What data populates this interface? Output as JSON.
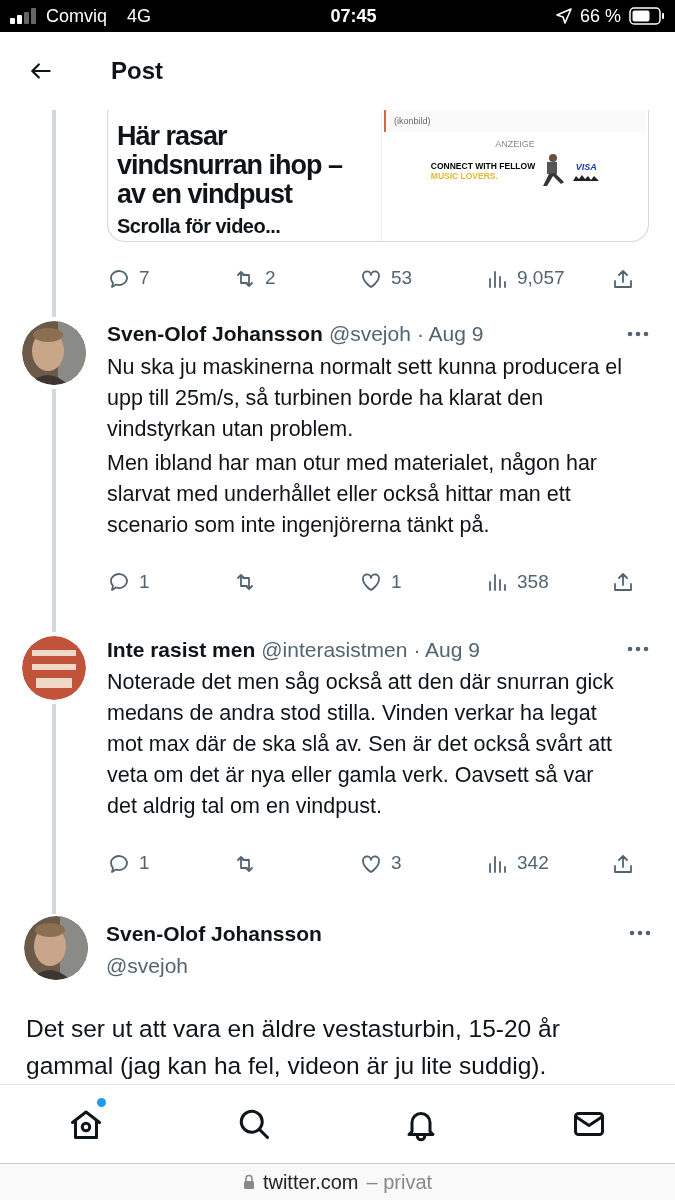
{
  "status_bar": {
    "carrier": "Comviq",
    "network": "4G",
    "time": "07:45",
    "battery": "66 %"
  },
  "header": {
    "title": "Post"
  },
  "link_card": {
    "headline": "Här rasar vindsnurran ihop – av en vindpust",
    "subline": "Scrolla för video...",
    "caption": "(ikonbild)",
    "ad_label": "ANZEIGE",
    "ad_line_1": "CONNECT WITH FELLOW",
    "ad_line_2": "MUSIC LOVERS.",
    "ad_brand": "VISA"
  },
  "card_actions": {
    "reply": "7",
    "retweet": "2",
    "like": "53",
    "views": "9,057"
  },
  "replies": [
    {
      "name": "Sven-Olof Johansson",
      "handle": "@svejoh",
      "date": "· Aug 9",
      "paragraphs": [
        "Nu ska ju maskinerna normalt sett kunna producera el upp till 25m/s, så turbinen borde ha klarat den vindstyrkan utan problem.",
        "Men ibland har man otur med materialet, någon har slarvat med underhållet eller också hittar man ett scenario som inte ingenjörerna tänkt på."
      ],
      "actions": {
        "reply": "1",
        "like": "1",
        "views": "358"
      }
    },
    {
      "name": "Inte rasist men",
      "handle": "@interasistmen",
      "date": "· Aug 9",
      "kind": "logo",
      "paragraphs": [
        "Noterade det men såg också att den där snurran gick medans de andra stod stilla. Vinden verkar ha legat mot max där de ska slå av. Sen är det också svårt att veta om det är nya eller gamla verk. Oavsett så var det aldrig tal om en vindpust."
      ],
      "actions": {
        "reply": "1",
        "like": "3",
        "views": "342"
      }
    }
  ],
  "main_post": {
    "name": "Sven-Olof Johansson",
    "handle": "@svejoh",
    "text": "Det ser ut att vara en äldre vestasturbin, 15-20 år gammal (jag kan ha fel, videon är ju lite suddig)."
  },
  "tab_bar": [
    {
      "kind": "home",
      "badge": true
    },
    {
      "kind": "search",
      "badge": false
    },
    {
      "kind": "notifications",
      "badge": false
    },
    {
      "kind": "messages",
      "badge": false
    }
  ],
  "browser_bar": {
    "domain": "twitter.com",
    "mode": "– privat"
  }
}
